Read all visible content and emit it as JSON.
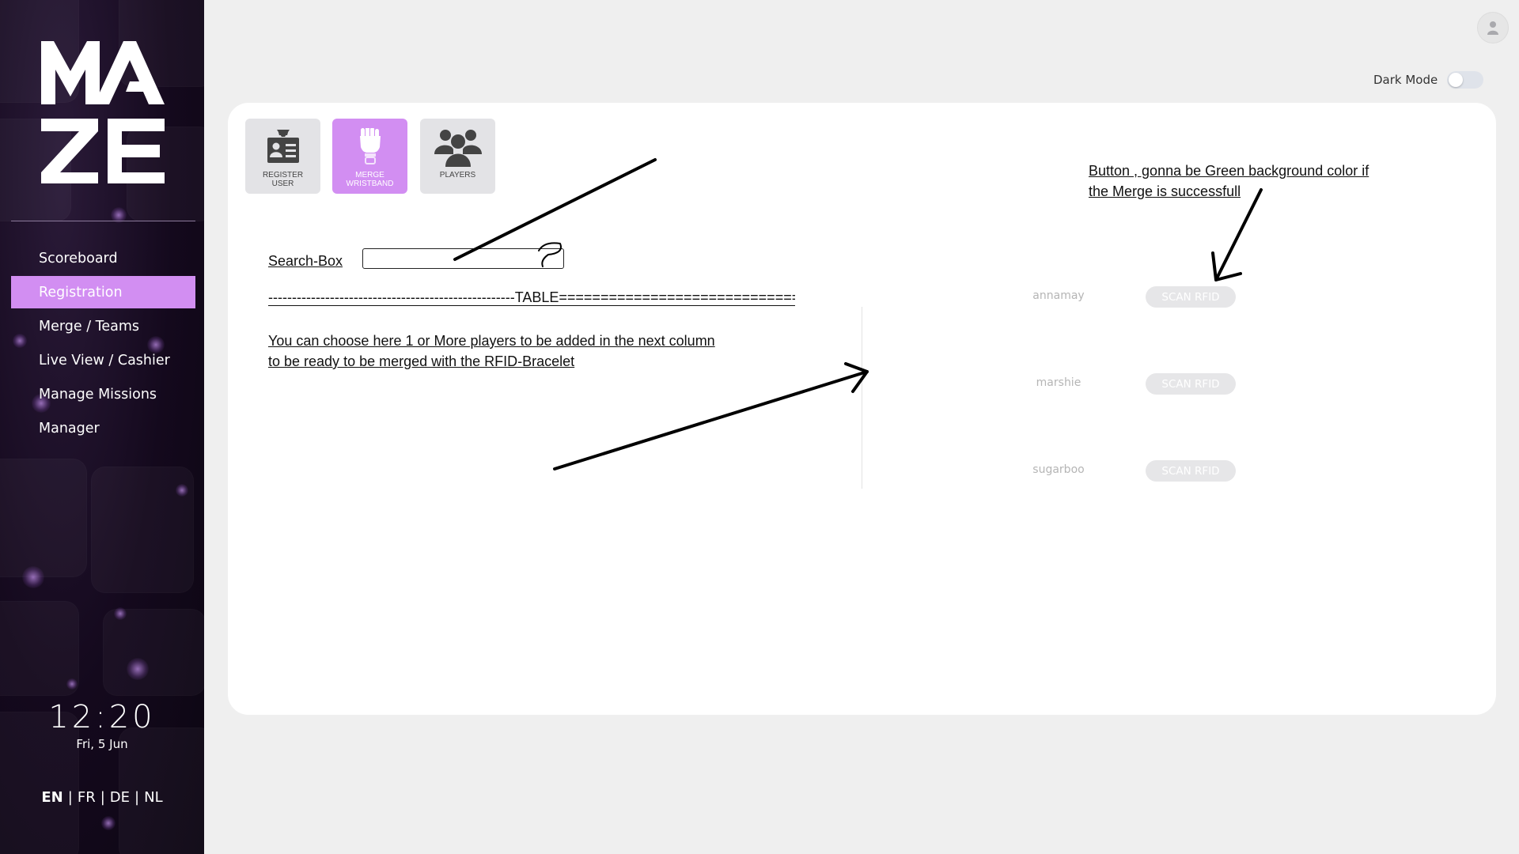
{
  "sidebar": {
    "nav": [
      {
        "label": "Scoreboard"
      },
      {
        "label": "Registration",
        "active": true
      },
      {
        "label": "Merge / Teams"
      },
      {
        "label": "Live View / Cashier"
      },
      {
        "label": "Manage Missions"
      },
      {
        "label": "Manager"
      }
    ],
    "clock": {
      "time": "12:20",
      "date": "Fri, 5 Jun"
    },
    "languages": [
      {
        "code": "EN",
        "active": true
      },
      {
        "code": "FR"
      },
      {
        "code": "DE"
      },
      {
        "code": "NL"
      }
    ],
    "accent_color": "#d28ef2"
  },
  "header": {
    "dark_mode_label": "Dark Mode",
    "dark_mode_on": false
  },
  "toolbar": {
    "buttons": [
      {
        "label": "Register User",
        "icon": "id-card-icon"
      },
      {
        "label": "Merge Wristband",
        "icon": "wristband-icon",
        "active": true
      },
      {
        "label": "Players",
        "icon": "players-icon"
      }
    ]
  },
  "annotations": {
    "search_label": "Search-Box",
    "table_marker": "----------------------------------------------------TABLE==============================",
    "choose_note_line1": "You can choose here 1 or More players to be added in the next column",
    "choose_note_line2": "to be ready to be merged with the RFID-Bracelet",
    "button_note_line1": "Button , gonna be Green background color if",
    "button_note_line2": "the Merge is successfull"
  },
  "players": [
    {
      "name": "annamay",
      "button": "SCAN RFID"
    },
    {
      "name": "marshie",
      "button": "SCAN RFID"
    },
    {
      "name": "sugarboo",
      "button": "SCAN RFID"
    }
  ]
}
